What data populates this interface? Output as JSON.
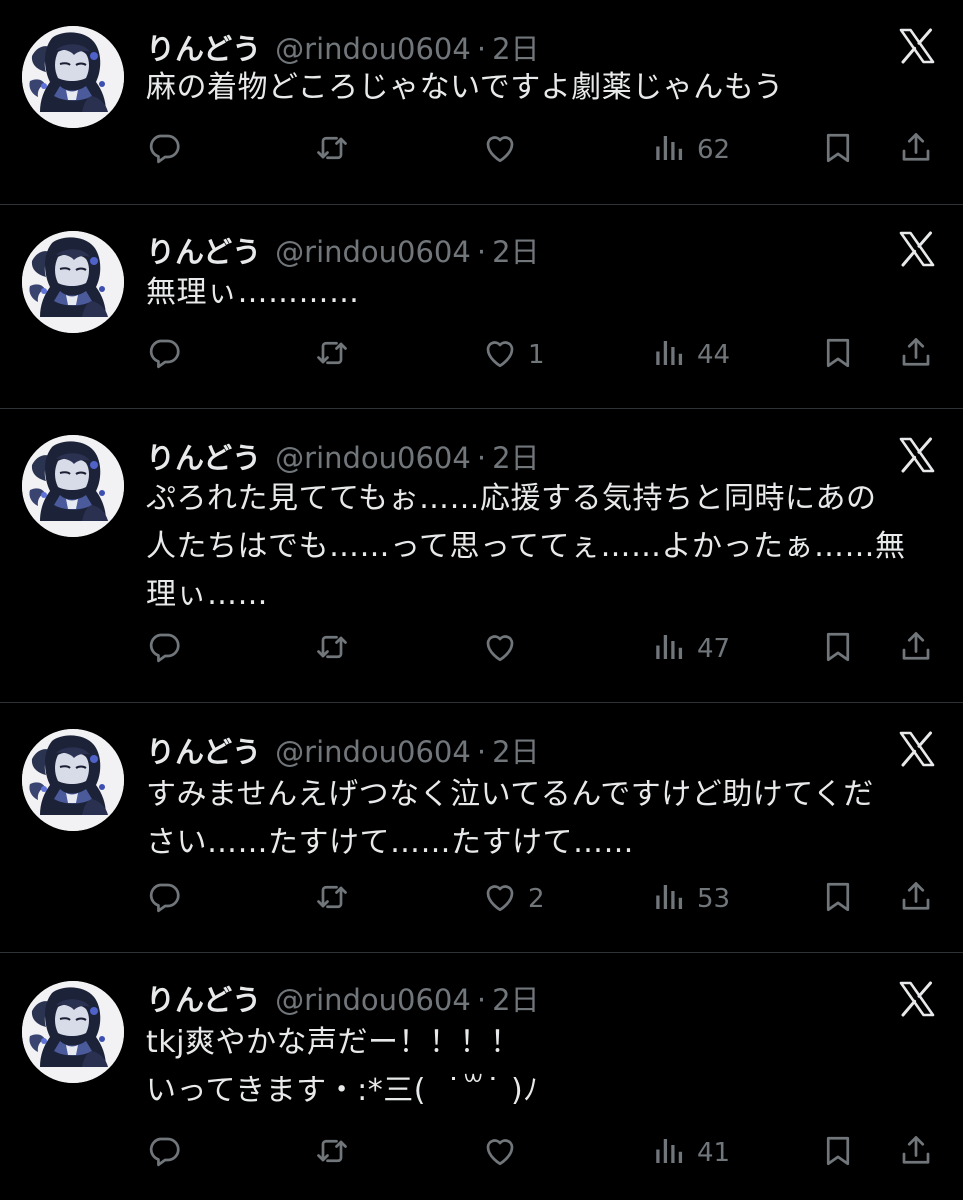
{
  "tweets": [
    {
      "name": "りんどう",
      "handle": "@rindou0604",
      "separator": "·",
      "time": "2日",
      "text": "麻の着物どころじゃないですよ劇薬じゃんもう",
      "likes": "",
      "views": "62"
    },
    {
      "name": "りんどう",
      "handle": "@rindou0604",
      "separator": "·",
      "time": "2日",
      "text": "無理ぃ…………",
      "likes": "1",
      "views": "44"
    },
    {
      "name": "りんどう",
      "handle": "@rindou0604",
      "separator": "·",
      "time": "2日",
      "text": "ぷろれた見ててもぉ……応援する気持ちと同時にあの\n人たちはでも……って思っててぇ……よかったぁ……無\n理ぃ……",
      "likes": "",
      "views": "47"
    },
    {
      "name": "りんどう",
      "handle": "@rindou0604",
      "separator": "·",
      "time": "2日",
      "text": "すみませんえげつなく泣いてるんですけど助けてくだ\nさい……たすけて……たすけて……",
      "likes": "2",
      "views": "53"
    },
    {
      "name": "りんどう",
      "handle": "@rindou0604",
      "separator": "·",
      "time": "2日",
      "text": "tkj爽やかな声だー！！！！\nいってきます・:*三(  ˙꒳˙ )ﾉ",
      "likes": "",
      "views": "41"
    }
  ],
  "colors": {
    "background": "#000000",
    "text": "#e7e9ea",
    "muted": "#71767b",
    "divider": "#2f3336"
  }
}
